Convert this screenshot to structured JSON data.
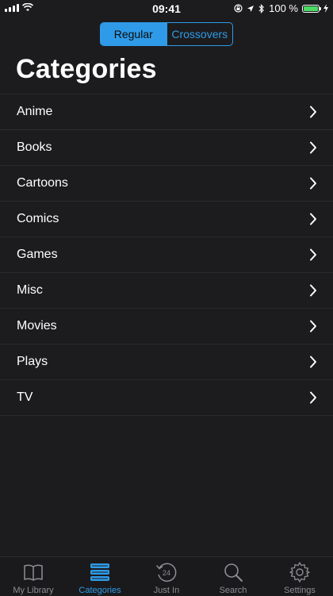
{
  "status": {
    "time": "09:41",
    "battery": "100 %"
  },
  "segment": {
    "regular": "Regular",
    "crossovers": "Crossovers"
  },
  "header": {
    "title": "Categories"
  },
  "categories": [
    {
      "label": "Anime"
    },
    {
      "label": "Books"
    },
    {
      "label": "Cartoons"
    },
    {
      "label": "Comics"
    },
    {
      "label": "Games"
    },
    {
      "label": "Misc"
    },
    {
      "label": "Movies"
    },
    {
      "label": "Plays"
    },
    {
      "label": "TV"
    }
  ],
  "tabs": [
    {
      "label": "My Library",
      "icon": "book-icon"
    },
    {
      "label": "Categories",
      "icon": "stack-icon"
    },
    {
      "label": "Just In",
      "icon": "clock-24-icon"
    },
    {
      "label": "Search",
      "icon": "search-icon"
    },
    {
      "label": "Settings",
      "icon": "gear-icon"
    }
  ],
  "colors": {
    "accent": "#2f9be8",
    "background": "#1c1c1e",
    "battery": "#4cd964"
  }
}
